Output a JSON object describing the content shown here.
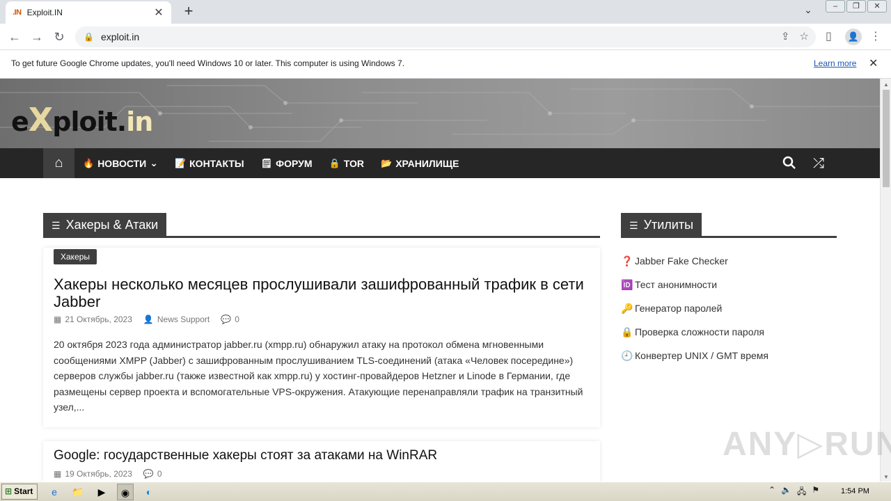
{
  "browser": {
    "tab": {
      "favicon": ".IN",
      "title": "Exploit.IN",
      "close": "✕"
    },
    "new_tab": "+",
    "url": "exploit.in",
    "infobar": {
      "message": "To get future Google Chrome updates, you'll need Windows 10 or later. This computer is using Windows 7.",
      "link": "Learn more"
    }
  },
  "site": {
    "logo": {
      "x": "X",
      "ploit": "ploit.",
      "in": "in",
      "e": "e"
    },
    "nav": [
      {
        "icon": "🔥",
        "label": "НОВОСТИ",
        "caret": "⌄"
      },
      {
        "icon": "📝",
        "label": "КОНТАКТЫ"
      },
      {
        "icon": "🗒",
        "label": "ФОРУМ"
      },
      {
        "icon": "🔒",
        "label": "TOR"
      },
      {
        "icon": "📂",
        "label": "ХРАНИЛИЩЕ"
      }
    ]
  },
  "main": {
    "section_title": "Хакеры & Атаки",
    "posts": [
      {
        "badge": "Хакеры",
        "title": "Хакеры несколько месяцев прослушивали зашифрованный трафик в сети Jabber",
        "date": "21 Октябрь, 2023",
        "author": "News Support",
        "comments": "0",
        "excerpt": "20 октября 2023 года администратор jabber.ru (xmpp.ru) обнаружил атаку на протокол обмена мгновенными сообщениями XMPP (Jabber) с зашифрованным прослушиванием TLS-соединений (атака «Человек посередине») серверов службы jabber.ru (также известной как xmpp.ru) у хостинг-провайдеров Hetzner и Linode в Германии, где размещены сервер проекта и вспомогательные VPS-окружения. Атакующие перенаправляли трафик на транзитный узел,..."
      },
      {
        "title": "Google: государственные хакеры стоят за атаками на WinRAR",
        "date": "19 Октябрь, 2023",
        "comments": "0"
      }
    ]
  },
  "sidebar": {
    "title": "Утилиты",
    "items": [
      {
        "icon": "❓",
        "label": "Jabber Fake Checker"
      },
      {
        "icon": "🆔",
        "label": "Тест анонимности"
      },
      {
        "icon": "🔑",
        "label": "Генератор паролей"
      },
      {
        "icon": "🔒",
        "label": "Проверка сложности пароля"
      },
      {
        "icon": "🕘",
        "label": "Конвертер UNIX / GMT время"
      }
    ]
  },
  "watermark": "ANY▷RUN",
  "taskbar": {
    "start": "Start",
    "clock": "1:54 PM"
  }
}
